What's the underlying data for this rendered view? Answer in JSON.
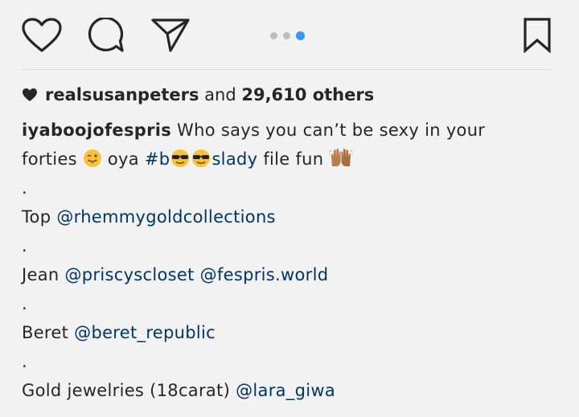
{
  "actions": {
    "like_icon": "heart-outline-icon",
    "comment_icon": "comment-bubble-icon",
    "share_icon": "paper-plane-icon",
    "save_icon": "bookmark-icon",
    "carousel": {
      "count": 3,
      "active_index": 2,
      "active_color": "#3897f0"
    }
  },
  "likes": {
    "user": "realsusanpeters",
    "connector": "and",
    "others": "29,610 others"
  },
  "caption": {
    "username": "iyaboojofespris",
    "line1_text": "Who says you can’t be sexy in your",
    "line2_pre": "forties",
    "line2_mid": "oya",
    "hashtag_a": "#b",
    "hashtag_b": "slady",
    "line2_post": "file fun",
    "dot": ".",
    "top_label": "Top",
    "top_mention": "@rhemmygoldcollections",
    "jean_label": "Jean",
    "jean_mention1": "@priscyscloset",
    "jean_mention2": "@fespris.world",
    "beret_label": "Beret",
    "beret_mention": "@beret_republic",
    "gold_label": "Gold jewelries (18carat)",
    "gold_mention": "@lara_giwa"
  },
  "colors": {
    "link": "#003569",
    "text": "#262626",
    "background": "#f2f2f2"
  }
}
